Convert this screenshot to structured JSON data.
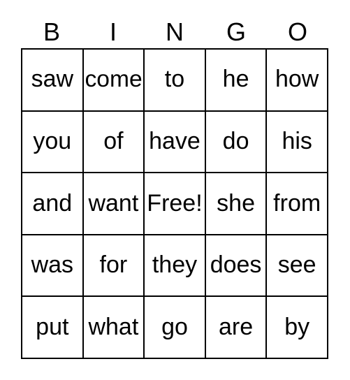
{
  "card": {
    "type": "bingo-card",
    "headers": [
      "B",
      "I",
      "N",
      "G",
      "O"
    ],
    "free_space_label": "Free!",
    "colors": {
      "background": "#ffffff",
      "border": "#000000",
      "text": "#000000"
    },
    "rows": [
      {
        "cells": [
          "saw",
          "come",
          "to",
          "he",
          "how"
        ]
      },
      {
        "cells": [
          "you",
          "of",
          "have",
          "do",
          "his"
        ]
      },
      {
        "cells": [
          "and",
          "want",
          "Free!",
          "she",
          "from"
        ]
      },
      {
        "cells": [
          "was",
          "for",
          "they",
          "does",
          "see"
        ]
      },
      {
        "cells": [
          "put",
          "what",
          "go",
          "are",
          "by"
        ]
      }
    ]
  }
}
